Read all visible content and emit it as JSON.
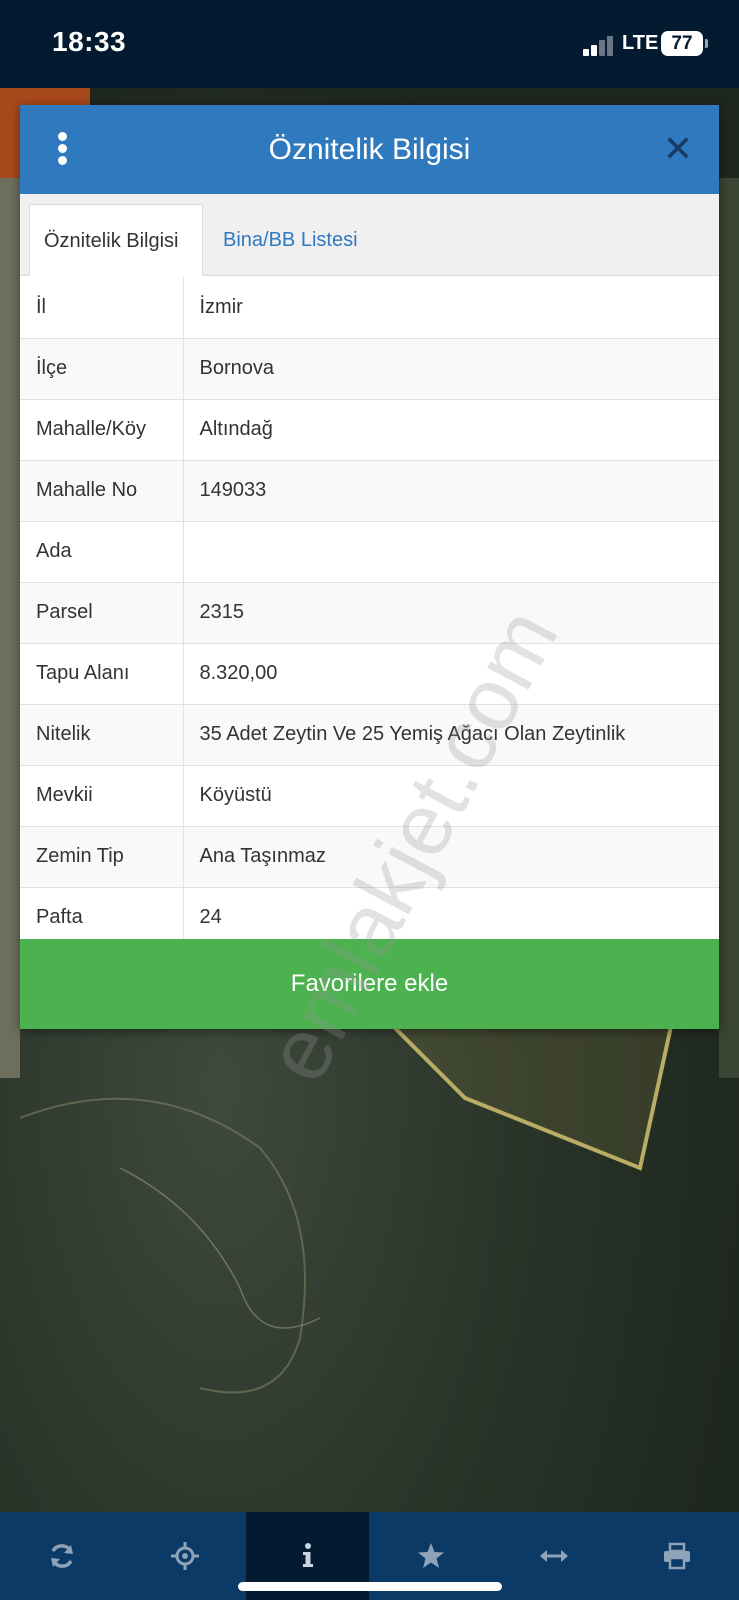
{
  "status_bar": {
    "time": "18:33",
    "network": "LTE",
    "battery": "77"
  },
  "dialog": {
    "title": "Öznitelik Bilgisi",
    "tabs": [
      {
        "label": "Öznitelik Bilgisi",
        "active": true
      },
      {
        "label": "Bina/BB Listesi",
        "active": false
      }
    ],
    "rows": [
      {
        "key": "İl",
        "value": "İzmir"
      },
      {
        "key": "İlçe",
        "value": "Bornova"
      },
      {
        "key": "Mahalle/Köy",
        "value": "Altındağ"
      },
      {
        "key": "Mahalle No",
        "value": "149033"
      },
      {
        "key": "Ada",
        "value": ""
      },
      {
        "key": "Parsel",
        "value": "2315"
      },
      {
        "key": "Tapu Alanı",
        "value": "8.320,00"
      },
      {
        "key": "Nitelik",
        "value": "35 Adet Zeytin Ve 25 Yemiş Ağacı Olan Zeytinlik"
      },
      {
        "key": "Mevkii",
        "value": "Köyüstü"
      },
      {
        "key": "Zemin Tip",
        "value": "Ana Taşınmaz"
      },
      {
        "key": "Pafta",
        "value": "24"
      }
    ],
    "favorite_button": "Favorilere ekle"
  },
  "watermark": "emlakjet.com",
  "toolbar": {
    "items": [
      {
        "icon": "refresh-icon",
        "active": false
      },
      {
        "icon": "locate-icon",
        "active": false
      },
      {
        "icon": "info-icon",
        "active": true
      },
      {
        "icon": "star-icon",
        "active": false
      },
      {
        "icon": "measure-icon",
        "active": false
      },
      {
        "icon": "print-icon",
        "active": false
      }
    ]
  },
  "colors": {
    "header_blue": "#2f79bf",
    "tab_link": "#2f79bf",
    "favorite_green": "#4cb14f",
    "toolbar_bg": "#0c3a66",
    "toolbar_active": "#031a30",
    "status_bg": "#031a30"
  }
}
